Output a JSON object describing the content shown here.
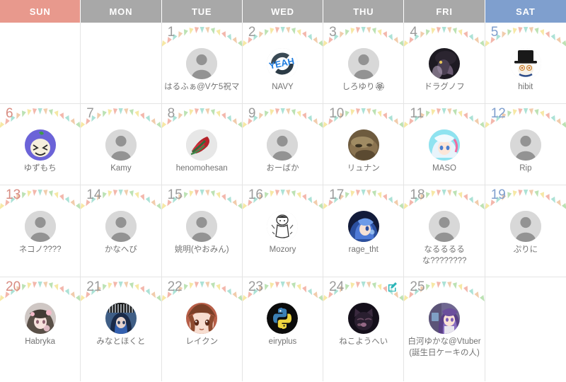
{
  "header": {
    "weekdays": [
      {
        "label": "SUN",
        "kind": "sun",
        "color": "#e8998d"
      },
      {
        "label": "MON",
        "kind": "weekday",
        "color": "#a8a8a8"
      },
      {
        "label": "TUE",
        "kind": "weekday",
        "color": "#a8a8a8"
      },
      {
        "label": "WED",
        "kind": "weekday",
        "color": "#a8a8a8"
      },
      {
        "label": "THU",
        "kind": "weekday",
        "color": "#a8a8a8"
      },
      {
        "label": "FRI",
        "kind": "weekday",
        "color": "#a8a8a8"
      },
      {
        "label": "SAT",
        "kind": "sat",
        "color": "#7f9fce"
      }
    ]
  },
  "theme": {
    "sunday_header_color": "#e8998d",
    "saturday_header_color": "#7f9fce",
    "weekday_header_color": "#a8a8a8",
    "grid_line_color": "#e4e4e4",
    "day_number_color": "#9b9b9b",
    "entry_name_color": "#737373",
    "edit_icon_color": "#2bb5b8",
    "bunting_colors": [
      "#b8e0b0",
      "#f5e7a0",
      "#f2b3a8",
      "#a8e0d4",
      "#f0c9a8"
    ]
  },
  "icons": {
    "edit": "edit-pencil-square-icon",
    "default_avatar": "default-person-avatar-icon"
  },
  "weeks": [
    {
      "row": 1,
      "days": [
        {
          "number": "",
          "weekday": "sun",
          "entry": null
        },
        {
          "number": "",
          "weekday": "mon",
          "entry": null
        },
        {
          "number": "1",
          "weekday": "tue",
          "entry": {
            "name": "はるふぁ@Vケ5祝マ",
            "avatar": "default"
          }
        },
        {
          "number": "2",
          "weekday": "wed",
          "entry": {
            "name": "NAVY",
            "avatar": "navy-yeah-logo"
          }
        },
        {
          "number": "3",
          "weekday": "thu",
          "entry": {
            "name": "しろゆり🏵",
            "avatar": "default"
          }
        },
        {
          "number": "4",
          "weekday": "fri",
          "entry": {
            "name": "ドラグノフ",
            "avatar": "dark-anime-portrait"
          }
        },
        {
          "number": "5",
          "weekday": "sat",
          "entry": {
            "name": "hibit",
            "avatar": "tophat-face"
          }
        }
      ]
    },
    {
      "row": 2,
      "days": [
        {
          "number": "6",
          "weekday": "sun",
          "entry": {
            "name": "ゆずもち",
            "avatar": "purple-mochi-face"
          }
        },
        {
          "number": "7",
          "weekday": "mon",
          "entry": {
            "name": "Kamy",
            "avatar": "default"
          }
        },
        {
          "number": "8",
          "weekday": "tue",
          "entry": {
            "name": "henomohesan",
            "avatar": "red-shoe-photo"
          }
        },
        {
          "number": "9",
          "weekday": "wed",
          "entry": {
            "name": "おーばか",
            "avatar": "default"
          }
        },
        {
          "number": "10",
          "weekday": "thu",
          "entry": {
            "name": "リュナン",
            "avatar": "brown-animal-photo"
          }
        },
        {
          "number": "11",
          "weekday": "fri",
          "entry": {
            "name": "MASO",
            "avatar": "white-hair-anime-girl"
          }
        },
        {
          "number": "12",
          "weekday": "sat",
          "entry": {
            "name": "Rip",
            "avatar": "default"
          }
        }
      ]
    },
    {
      "row": 3,
      "days": [
        {
          "number": "13",
          "weekday": "sun",
          "entry": {
            "name": "ネコノ????",
            "avatar": "default"
          }
        },
        {
          "number": "14",
          "weekday": "mon",
          "entry": {
            "name": "かなへび",
            "avatar": "default"
          }
        },
        {
          "number": "15",
          "weekday": "tue",
          "entry": {
            "name": "姚明(やおみん)",
            "avatar": "default"
          }
        },
        {
          "number": "16",
          "weekday": "wed",
          "entry": {
            "name": "Mozory",
            "avatar": "sketch-doodle-figure"
          }
        },
        {
          "number": "17",
          "weekday": "thu",
          "entry": {
            "name": "rage_tht",
            "avatar": "blue-hair-anime-girl"
          }
        },
        {
          "number": "18",
          "weekday": "fri",
          "entry": {
            "name": "なるるるるな????????",
            "avatar": "default"
          }
        },
        {
          "number": "19",
          "weekday": "sat",
          "entry": {
            "name": "ぷりに",
            "avatar": "default"
          }
        }
      ]
    },
    {
      "row": 4,
      "days": [
        {
          "number": "20",
          "weekday": "sun",
          "entry": {
            "name": "Habryka",
            "avatar": "grey-hair-anime-portrait"
          }
        },
        {
          "number": "21",
          "weekday": "mon",
          "entry": {
            "name": "みなとほくと",
            "avatar": "blue-hair-dark-portrait"
          }
        },
        {
          "number": "22",
          "weekday": "tue",
          "entry": {
            "name": "レイクン",
            "avatar": "brown-hair-anime-face"
          }
        },
        {
          "number": "23",
          "weekday": "wed",
          "entry": {
            "name": "eiryplus",
            "avatar": "python-logo"
          }
        },
        {
          "number": "24",
          "weekday": "thu",
          "entry": {
            "name": "ねこようへい",
            "avatar": "black-cat-portrait"
          },
          "edit_button": true
        },
        {
          "number": "25",
          "weekday": "fri",
          "entry": {
            "name": "白河ゆかな@Vtuber(誕生日ケーキの人)",
            "avatar": "purple-hair-vtuber"
          }
        },
        {
          "number": "",
          "weekday": "sat",
          "entry": null
        }
      ]
    }
  ]
}
